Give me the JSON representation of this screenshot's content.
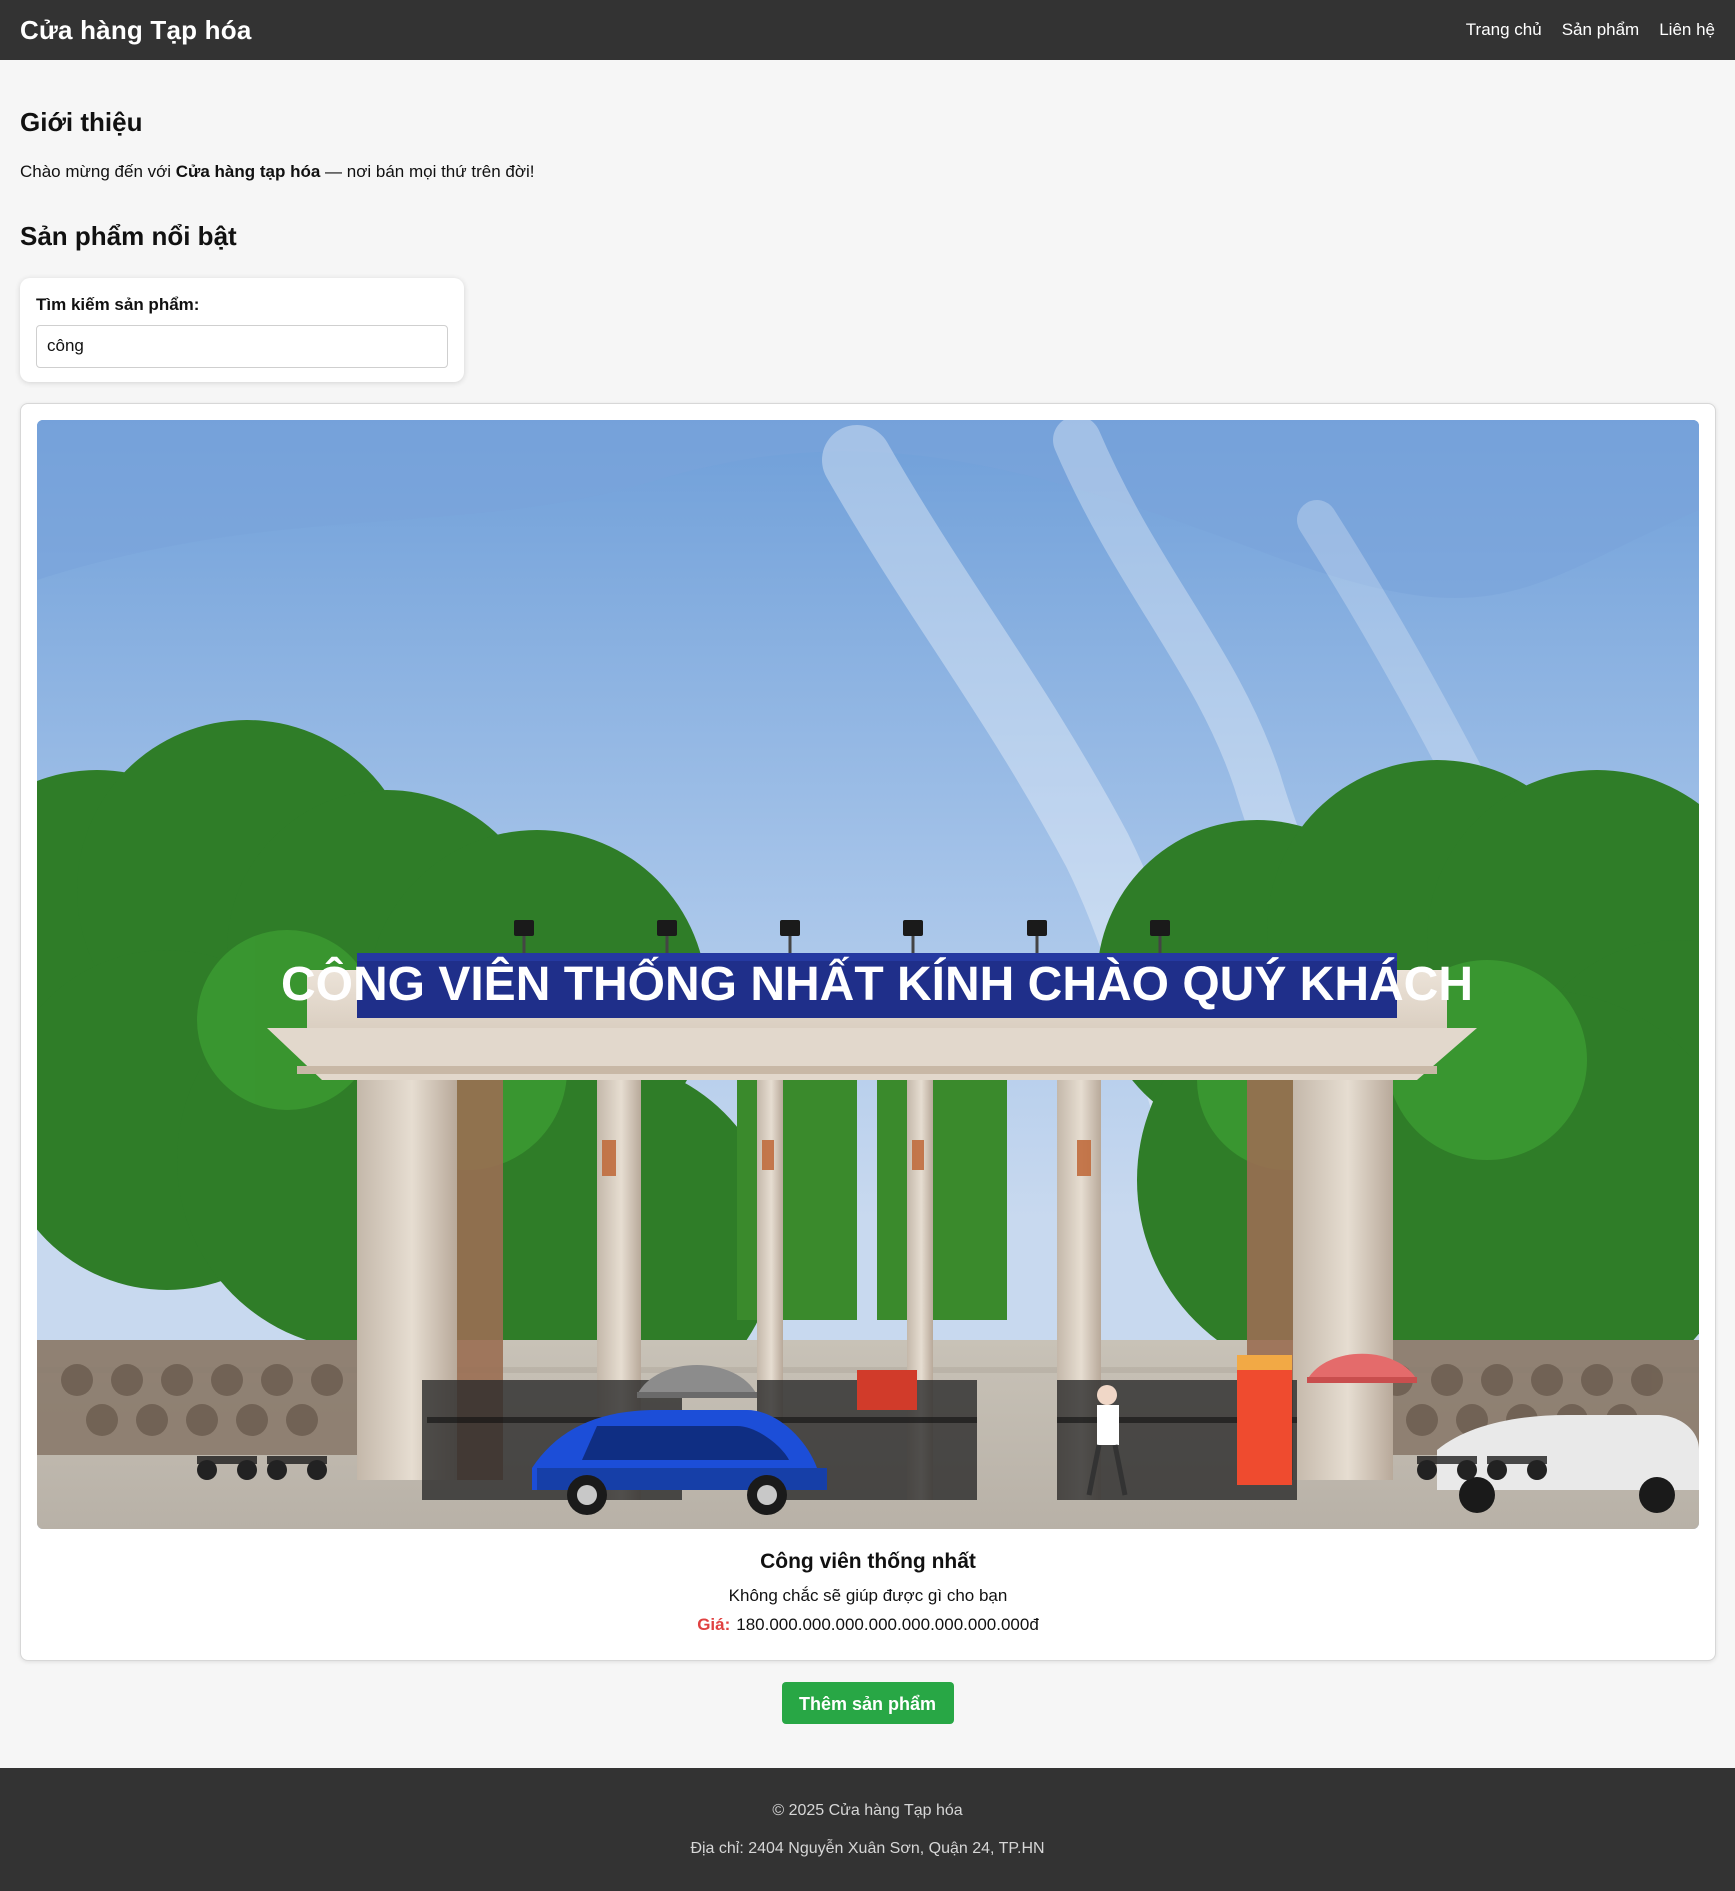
{
  "header": {
    "brand": "Cửa hàng Tạp hóa",
    "nav": [
      "Trang chủ",
      "Sản phẩm",
      "Liên hệ"
    ]
  },
  "intro": {
    "title": "Giới thiệu",
    "text_before": "Chào mừng đến với ",
    "text_bold": "Cửa hàng tạp hóa",
    "text_after": " — nơi bán mọi thứ trên đời!"
  },
  "featured": {
    "title": "Sản phẩm nổi bật"
  },
  "search": {
    "label": "Tìm kiếm sản phẩm:",
    "value": "công"
  },
  "product": {
    "image_sign_text": "CÔNG VIÊN THỐNG NHẤT KÍNH CHÀO QUÝ KHÁCH",
    "name": "Công viên thống nhất",
    "description": "Không chắc sẽ giúp được gì cho bạn",
    "price_label": "Giá:",
    "price_value": "180.000.000.000.000.000.000.000.000đ"
  },
  "actions": {
    "add_product": "Thêm sản phẩm"
  },
  "footer": {
    "copyright": "© 2025 Cửa hàng Tạp hóa",
    "address": "Địa chỉ: 2404 Nguyễn Xuân Sơn, Quận 24, TP.HN"
  },
  "colors": {
    "header_bg": "#333333",
    "accent_green": "#28a745",
    "price_red": "#e04141",
    "sign_blue": "#1f2f8a"
  }
}
